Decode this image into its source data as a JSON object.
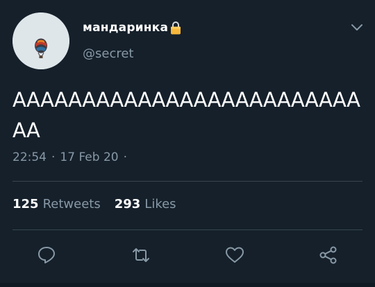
{
  "author": {
    "display_name": "мандаринка",
    "handle": "@secret",
    "avatar_icon": "hot-air-balloon-icon",
    "lock_icon": "padlock-icon"
  },
  "tweet": {
    "text": "AAAAAAAAAAAAAAAAAAAAAAAAAAA",
    "time": "22:54",
    "date": "17 Feb 20",
    "sep1": "·",
    "sep2": "·"
  },
  "stats": {
    "retweets_count": "125",
    "retweets_label": "Retweets",
    "likes_count": "293",
    "likes_label": "Likes"
  },
  "actions": [
    "reply-icon",
    "retweet-icon",
    "like-icon",
    "share-icon"
  ],
  "colors": {
    "background": "#15202b",
    "secondary_text": "#8899a6",
    "divider": "#38444d",
    "lock": "#f6b73c"
  }
}
